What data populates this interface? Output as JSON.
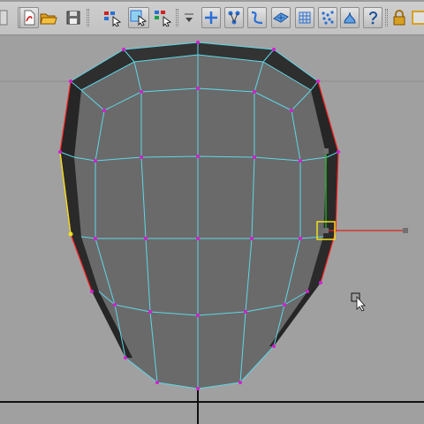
{
  "toolbar": {
    "icons": [
      "toolbar-edge-icon",
      "document-icon",
      "pdf-icon",
      "open-folder-icon",
      "save-icon",
      "select-by-name-icon",
      "select-region-icon",
      "select-object-icon",
      "snap-dropdown-icon",
      "move-icon",
      "hierarchy-icon",
      "curve-icon",
      "plane-icon",
      "lattice-icon",
      "particles-icon",
      "fluid-icon",
      "help-icon",
      "lock-icon",
      "window-icon"
    ],
    "accent_colors": {
      "blue": "#2a6fd6",
      "red": "#d02020",
      "green": "#1aa04a",
      "gold": "#d8a020"
    }
  },
  "viewport": {
    "mesh": {
      "colors": {
        "face_light": "#6e6e6e",
        "face_dark": "#2e2e2e",
        "wire": "#5fd7e8",
        "vertex": "#d020d0",
        "selected_edge": "#ff2020",
        "highlight_edge": "#f0e020"
      }
    },
    "manipulator": {
      "x_axis_color": "#e02020",
      "y_axis_color": "#20c020",
      "handle_color": "#f0e020"
    },
    "cursor": "pointer-cursor-icon",
    "grid_color": "#101010",
    "background": "#a0a0a0"
  }
}
